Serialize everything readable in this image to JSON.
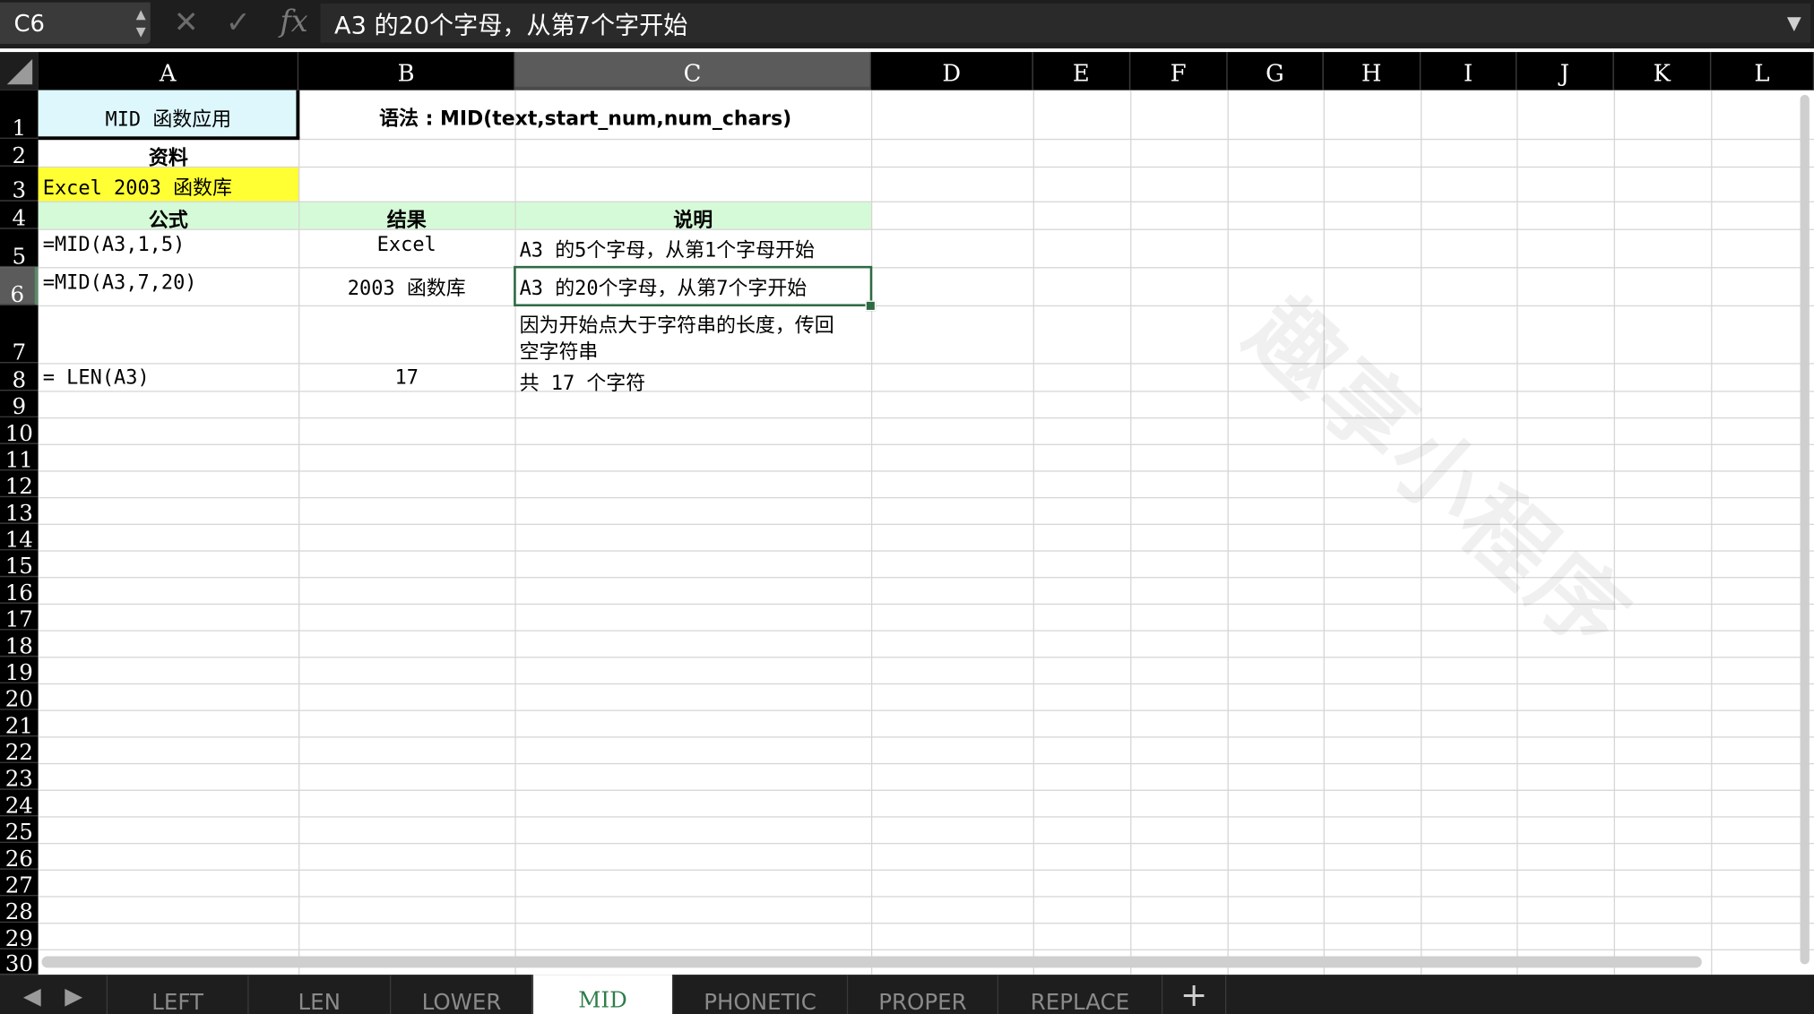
{
  "formula_bar": {
    "name_box": "C6",
    "cancel_icon": "x-icon",
    "confirm_icon": "check-icon",
    "fx_label": "fx",
    "formula": "A3 的20个字母，从第7个字开始"
  },
  "columns": [
    "A",
    "B",
    "C",
    "D",
    "E",
    "F",
    "G",
    "H",
    "I",
    "J",
    "K",
    "L"
  ],
  "rows": [
    "1",
    "2",
    "3",
    "4",
    "5",
    "6",
    "7",
    "8",
    "9",
    "10",
    "11",
    "12",
    "13",
    "14",
    "15",
    "16",
    "17",
    "18",
    "19",
    "20",
    "21",
    "22",
    "23",
    "24",
    "25",
    "26",
    "27",
    "28",
    "29",
    "30"
  ],
  "cells": {
    "A1": "MID 函数应用",
    "B1": "语法 : MID(text,start_num,num_chars)",
    "A2": "资料",
    "A3": "Excel 2003 函数库",
    "A4": "公式",
    "B4": "结果",
    "C4": "说明",
    "A5": "=MID(A3,1,5)",
    "B5": "Excel",
    "C5": "A3 的5个字母，从第1个字母开始",
    "A6": "=MID(A3,7,20)",
    "B6": "2003 函数库",
    "C6": "A3 的20个字母，从第7个字开始",
    "C7_line1": "因为开始点大于字符串的长度，传回",
    "C7_line2": "空字符串",
    "A8": "= LEN(A3)",
    "B8": "17",
    "C8": "共 17 个字符"
  },
  "watermark": "趣享小程序",
  "colors": {
    "header_bg": "#000000",
    "selected_header_bg": "#5b5b5b",
    "a1_fill": "#ddf7fc",
    "a3_fill": "#ffff33",
    "row4_fill": "#d5fad7",
    "selection": "#2e6b43",
    "active_tab_text": "#2e7d4a"
  },
  "tabs": {
    "nav_prev_icon": "triangle-left-icon",
    "nav_next_icon": "triangle-right-icon",
    "items": [
      {
        "label": "LEFT",
        "active": false
      },
      {
        "label": "LEN",
        "active": false
      },
      {
        "label": "LOWER",
        "active": false
      },
      {
        "label": "MID",
        "active": true
      },
      {
        "label": "PHONETIC",
        "active": false
      },
      {
        "label": "PROPER",
        "active": false
      },
      {
        "label": "REPLACE",
        "active": false
      }
    ],
    "add_label": "+"
  }
}
